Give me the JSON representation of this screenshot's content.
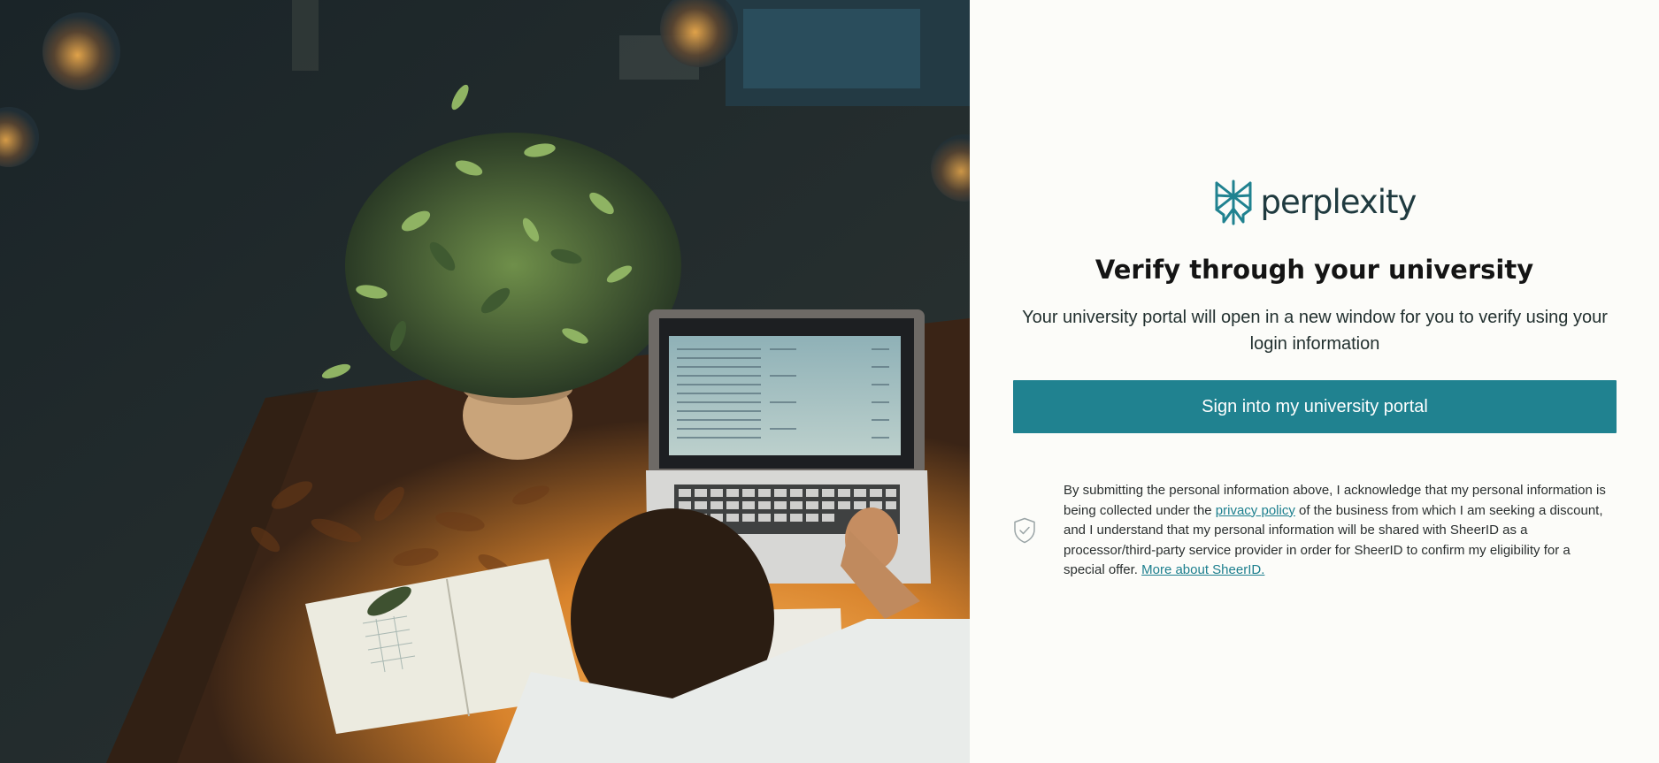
{
  "brand": {
    "name": "perplexity",
    "color": "#1f3a3f",
    "accent": "#208290"
  },
  "hero": {
    "description_icon": "student-laptop-illustration"
  },
  "verify": {
    "title": "Verify through your university",
    "subtitle": "Your university portal will open in a new window for you to verify using your login information",
    "button_label": "Sign into my university portal"
  },
  "consent": {
    "icon": "shield-check-icon",
    "text_before_link": "By submitting the personal information above, I acknowledge that my personal information is being collected under the ",
    "privacy_link": "privacy policy",
    "text_after_link": " of the business from which I am seeking a discount, and I understand that my personal information will be shared with SheerID as a processor/third-party service provider in order for SheerID to confirm my eligibility for a special offer. ",
    "more_link": "More about SheerID."
  }
}
